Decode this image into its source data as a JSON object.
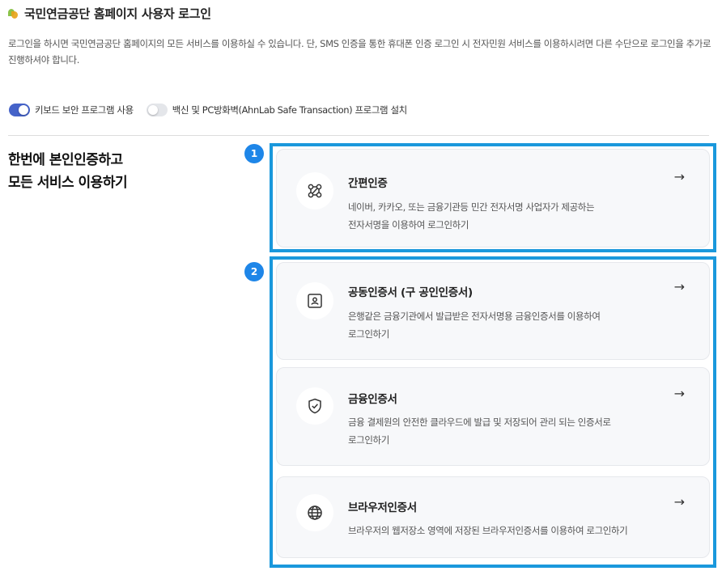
{
  "header": {
    "title": "국민연금공단 홈페이지 사용자 로그인",
    "description": "로그인을 하시면 국민연금공단 홈페이지의 모든 서비스를 이용하실 수 있습니다. 단, SMS 인증을 통한 휴대폰 인증 로그인 시 전자민원 서비스를 이용하시려면 다른 수단으로 로그인을 추가로 진행하셔야 합니다."
  },
  "toggles": [
    {
      "label": "키보드 보안 프로그램 사용",
      "state": "on"
    },
    {
      "label": "백신 및 PC방화벽(AhnLab Safe Transaction) 프로그램 설치",
      "state": "off"
    }
  ],
  "side": {
    "line1": "한번에 본인인증하고",
    "line2": "모든 서비스 이용하기"
  },
  "badges": [
    "1",
    "2"
  ],
  "cards": [
    {
      "title": "간편인증",
      "desc1": "네이버, 카카오, 또는 금융기관등 민간 전자서명 사업자가 제공하는",
      "desc2": "전자서명을 이용하여 로그인하기",
      "icon": "share-link-icon",
      "arrow": "→"
    },
    {
      "title": "공동인증서 (구 공인인증서)",
      "desc1": "은행같은 금융기관에서 발급받은 전자서명용 금융인증서를 이용하여",
      "desc2": "로그인하기",
      "icon": "id-card-icon",
      "arrow": "→"
    },
    {
      "title": "금융인증서",
      "desc1": "금융 결제원의 안전한 클라우드에 발급 및 저장되어 관리 되는 인증서로",
      "desc2": "로그인하기",
      "icon": "shield-check-icon",
      "arrow": "→"
    },
    {
      "title": "브라우저인증서",
      "desc1": "브라우저의 웹저장소 영역에 저장된 브라우저인증서를 이용하여 로그인하기",
      "icon": "globe-icon",
      "arrow": "→"
    }
  ],
  "colors": {
    "highlight_border": "#1a98dc",
    "badge": "#1e86e8",
    "toggle_on": "#4563c9"
  }
}
